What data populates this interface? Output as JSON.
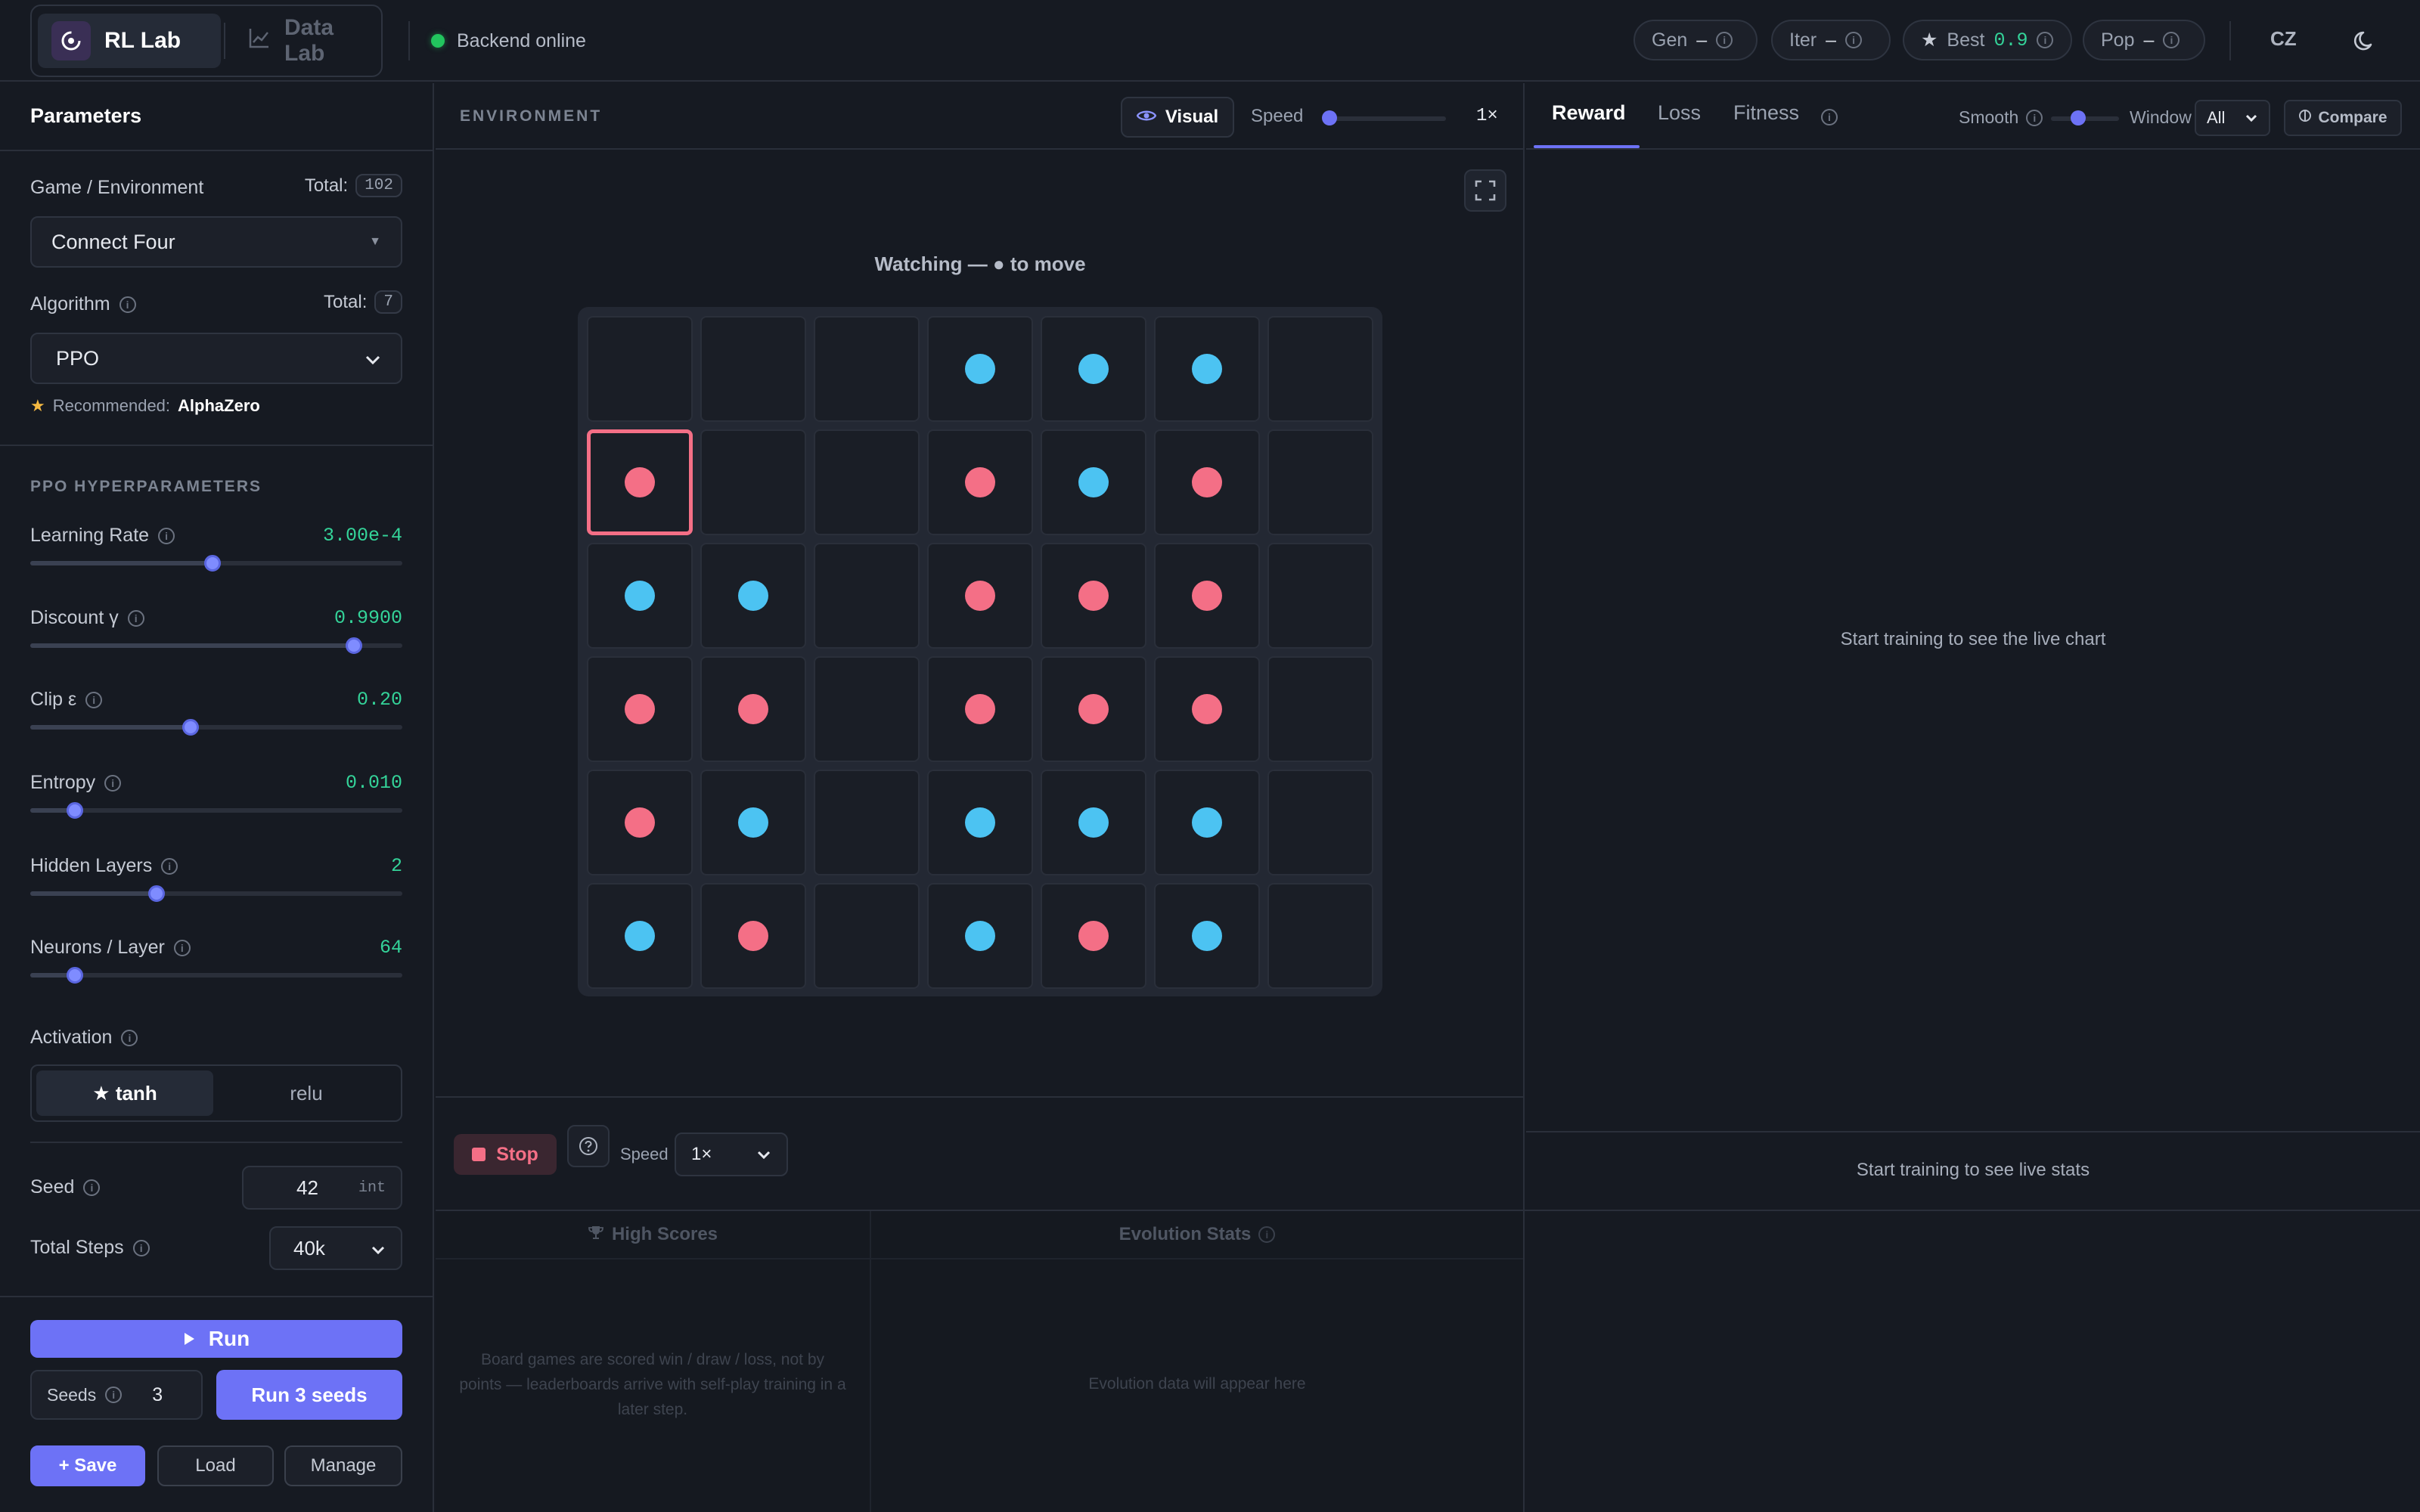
{
  "topbar": {
    "apps": [
      {
        "label": "RL Lab",
        "icon": "rl-logo-icon",
        "active": true
      },
      {
        "label": "Data Lab",
        "icon": "chart-icon",
        "active": false
      }
    ],
    "backend_status": "Backend online",
    "stats": {
      "gen_label": "Gen",
      "gen_value": "–",
      "iter_label": "Iter",
      "iter_value": "–",
      "best_label": "Best",
      "best_value": "0.9",
      "pop_label": "Pop",
      "pop_value": "–"
    },
    "language": "CZ",
    "theme_icon": "moon-icon"
  },
  "params": {
    "title": "Parameters",
    "game_label": "Game / Environment",
    "game_total_label": "Total:",
    "game_total": "102",
    "game_value": "Connect Four",
    "algo_label": "Algorithm",
    "algo_total_label": "Total:",
    "algo_total": "7",
    "algo_value": "PPO",
    "recommended_label": "Recommended:",
    "recommended_value": "AlphaZero",
    "section": "PPO HYPERPARAMETERS",
    "hyper": [
      {
        "name": "Learning Rate",
        "value": "3.00e-4",
        "level": 0.49
      },
      {
        "name": "Discount γ",
        "value": "0.9900",
        "level": 0.87
      },
      {
        "name": "Clip ε",
        "value": "0.20",
        "level": 0.43
      },
      {
        "name": "Entropy",
        "value": "0.010",
        "level": 0.12
      },
      {
        "name": "Hidden Layers",
        "value": "2",
        "level": 0.34
      },
      {
        "name": "Neurons / Layer",
        "value": "64",
        "level": 0.12
      }
    ],
    "activation_label": "Activation",
    "activation_options": [
      "★ tanh",
      "relu"
    ],
    "seed_label": "Seed",
    "seed_value": "42",
    "seed_unit": "int",
    "steps_label": "Total Steps",
    "steps_value": "40k",
    "run_label": "Run",
    "seeds_label": "Seeds",
    "seeds_value": "3",
    "run_seeds_label": "Run 3 seeds",
    "save_label": "+ Save",
    "load_label": "Load",
    "manage_label": "Manage"
  },
  "env": {
    "title": "ENVIRONMENT",
    "visual_label": "Visual",
    "speed_label": "Speed",
    "speed_value": "1×",
    "watching_text": "Watching — ● to move",
    "board": [
      [
        "",
        "",
        "",
        "blue",
        "blue",
        "blue",
        ""
      ],
      [
        "red",
        "",
        "",
        "red",
        "blue",
        "red",
        ""
      ],
      [
        "blue",
        "blue",
        "",
        "red",
        "red",
        "red",
        ""
      ],
      [
        "red",
        "red",
        "",
        "red",
        "red",
        "red",
        ""
      ],
      [
        "red",
        "blue",
        "",
        "blue",
        "blue",
        "blue",
        ""
      ],
      [
        "blue",
        "red",
        "",
        "blue",
        "red",
        "blue",
        ""
      ]
    ],
    "stop_label": "Stop",
    "speed2_label": "Speed",
    "speed2_value": "1×",
    "colors": {
      "red": "#f46f86",
      "blue": "#4cc3f2"
    }
  },
  "chart": {
    "tabs": [
      "Reward",
      "Loss",
      "Fitness"
    ],
    "smooth_label": "Smooth",
    "window_label": "Window",
    "window_value": "All",
    "compare_label": "Compare",
    "empty_chart": "Start training to see the live chart",
    "empty_stats": "Start training to see live stats"
  },
  "bottom": {
    "scores_title": "High Scores",
    "scores_msg": "Board games are scored win / draw / loss, not by points — leaderboards arrive with self-play training in a later step.",
    "evo_title": "Evolution Stats",
    "evo_msg": "Evolution data will appear here"
  }
}
